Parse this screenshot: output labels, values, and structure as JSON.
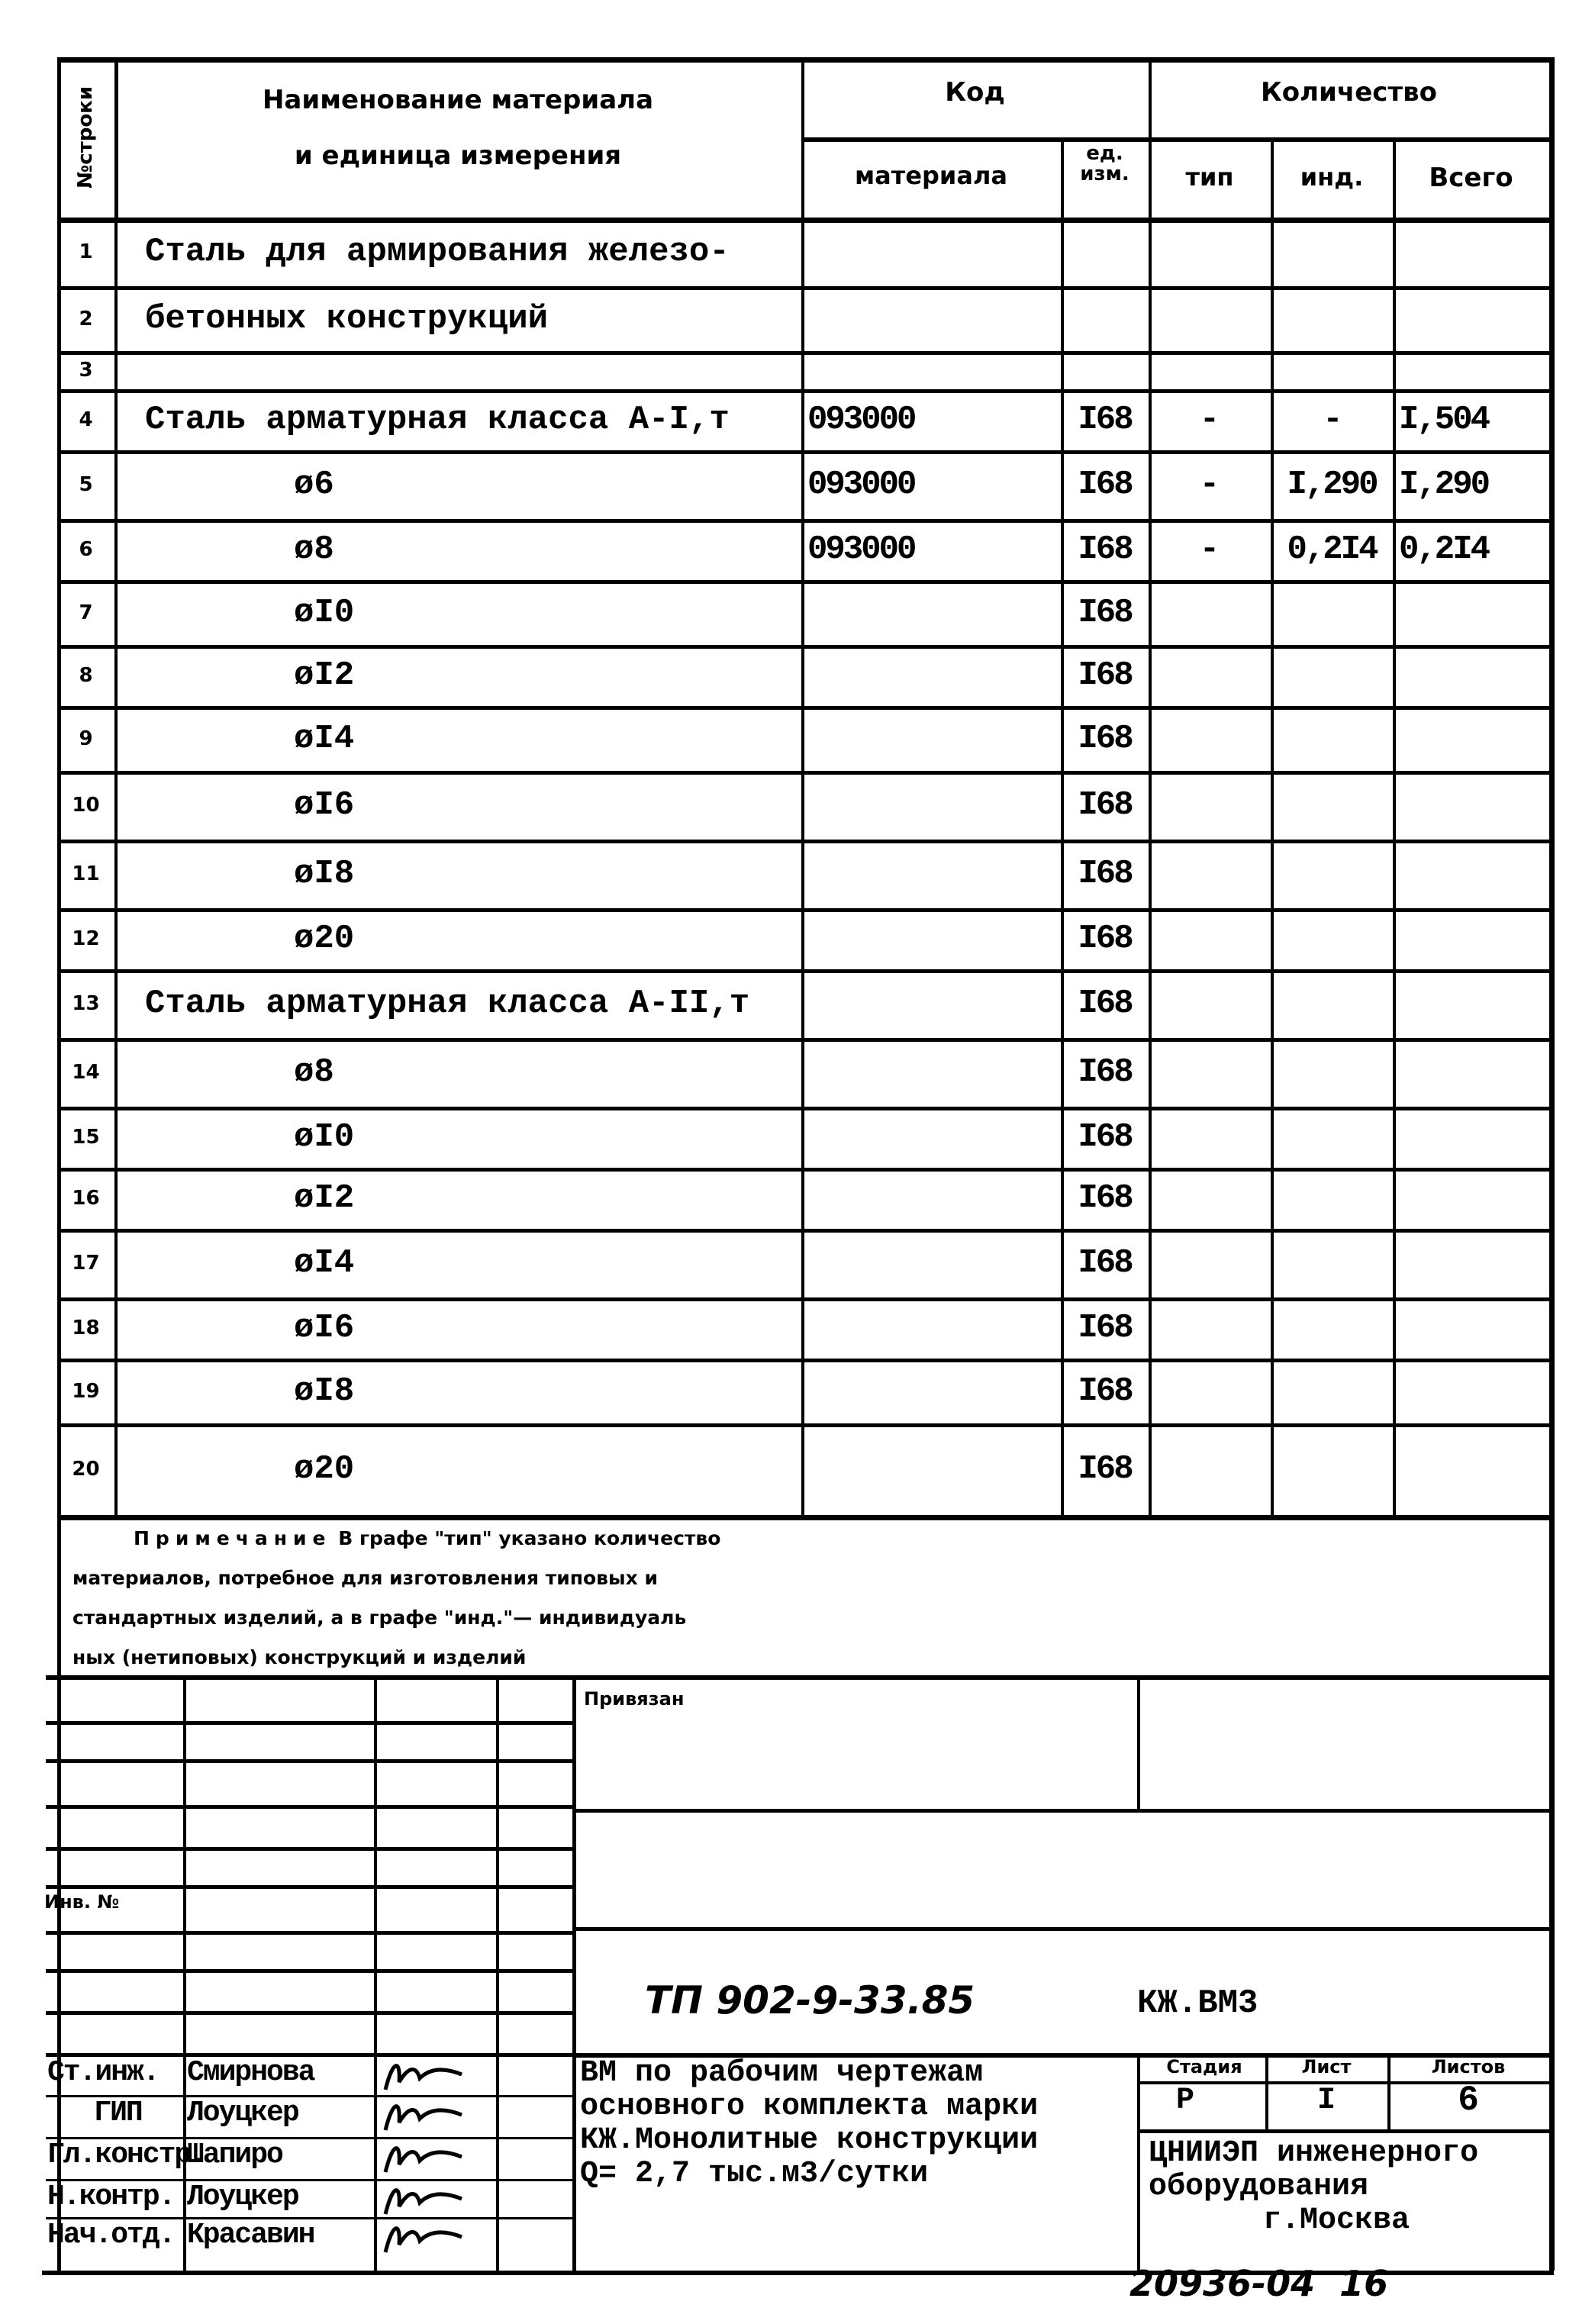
{
  "header": {
    "row_no_label": "№строки",
    "name_label_line1": "Наименование материала",
    "name_label_line2": "и единица измерения",
    "code_group": "Код",
    "code_material": "материала",
    "code_unit_line1": "ед.",
    "code_unit_line2": "изм.",
    "quantity_group": "Количество",
    "qty_type": "тип",
    "qty_ind": "инд.",
    "qty_total": "Всего"
  },
  "rows": [
    {
      "no": "1",
      "name": "Сталь для армирования железо-",
      "indent": false,
      "code": "",
      "unit": "",
      "type": "",
      "ind": "",
      "total": ""
    },
    {
      "no": "2",
      "name": "бетонных конструкций",
      "indent": false,
      "code": "",
      "unit": "",
      "type": "",
      "ind": "",
      "total": ""
    },
    {
      "no": "3",
      "name": "",
      "indent": false,
      "code": "",
      "unit": "",
      "type": "",
      "ind": "",
      "total": ""
    },
    {
      "no": "4",
      "name": "Сталь арматурная класса А-I,т",
      "indent": false,
      "code": "093000",
      "unit": "I68",
      "type": "-",
      "ind": "-",
      "total": "I,504"
    },
    {
      "no": "5",
      "name": "ø6",
      "indent": true,
      "code": "093000",
      "unit": "I68",
      "type": "-",
      "ind": "I,290",
      "total": "I,290"
    },
    {
      "no": "6",
      "name": "ø8",
      "indent": true,
      "code": "093000",
      "unit": "I68",
      "type": "-",
      "ind": "0,2I4",
      "total": "0,2I4"
    },
    {
      "no": "7",
      "name": "øI0",
      "indent": true,
      "code": "",
      "unit": "I68",
      "type": "",
      "ind": "",
      "total": ""
    },
    {
      "no": "8",
      "name": "øI2",
      "indent": true,
      "code": "",
      "unit": "I68",
      "type": "",
      "ind": "",
      "total": ""
    },
    {
      "no": "9",
      "name": "øI4",
      "indent": true,
      "code": "",
      "unit": "I68",
      "type": "",
      "ind": "",
      "total": ""
    },
    {
      "no": "10",
      "name": "øI6",
      "indent": true,
      "code": "",
      "unit": "I68",
      "type": "",
      "ind": "",
      "total": ""
    },
    {
      "no": "11",
      "name": "øI8",
      "indent": true,
      "code": "",
      "unit": "I68",
      "type": "",
      "ind": "",
      "total": ""
    },
    {
      "no": "12",
      "name": "ø20",
      "indent": true,
      "code": "",
      "unit": "I68",
      "type": "",
      "ind": "",
      "total": ""
    },
    {
      "no": "13",
      "name": "Сталь арматурная класса А-II,т",
      "indent": false,
      "code": "",
      "unit": "I68",
      "type": "",
      "ind": "",
      "total": ""
    },
    {
      "no": "14",
      "name": "ø8",
      "indent": true,
      "code": "",
      "unit": "I68",
      "type": "",
      "ind": "",
      "total": ""
    },
    {
      "no": "15",
      "name": "øI0",
      "indent": true,
      "code": "",
      "unit": "I68",
      "type": "",
      "ind": "",
      "total": ""
    },
    {
      "no": "16",
      "name": "øI2",
      "indent": true,
      "code": "",
      "unit": "I68",
      "type": "",
      "ind": "",
      "total": ""
    },
    {
      "no": "17",
      "name": "øI4",
      "indent": true,
      "code": "",
      "unit": "I68",
      "type": "",
      "ind": "",
      "total": ""
    },
    {
      "no": "18",
      "name": "øI6",
      "indent": true,
      "code": "",
      "unit": "I68",
      "type": "",
      "ind": "",
      "total": ""
    },
    {
      "no": "19",
      "name": "øI8",
      "indent": true,
      "code": "",
      "unit": "I68",
      "type": "",
      "ind": "",
      "total": ""
    },
    {
      "no": "20",
      "name": "ø20",
      "indent": true,
      "code": "",
      "unit": "I68",
      "type": "",
      "ind": "",
      "total": ""
    }
  ],
  "note": {
    "lead": "Примечание",
    "line1_rest": "В графе \"тип\" указано количество",
    "line2": "материалов, потребное для изготовления типовых и",
    "line3": "стандартных изделий, а в графе \"инд.\"— индивидуаль",
    "line4": "ных (нетиповых) конструкций и изделий"
  },
  "title_block": {
    "bound_label": "Привязан",
    "inv_no_label": "Инв. №",
    "doc_code": "ТП 902-9-33.85",
    "doc_mark": "КЖ.ВМ3",
    "signatures": [
      {
        "role": "Ст.инж.",
        "name": "Смирнова"
      },
      {
        "role": "ГИП",
        "name": "Лоуцкер"
      },
      {
        "role": "Гл.констр.",
        "name": "Шапиро"
      },
      {
        "role": "Н.контр.",
        "name": "Лоуцкер"
      },
      {
        "role": "Нач.отд.",
        "name": "Красавин"
      }
    ],
    "description_lines": [
      "ВМ по рабочим чертежам",
      "основного комплекта марки",
      "КЖ.Монолитные конструкции",
      "Q= 2,7 тыс.м3/сутки"
    ],
    "stage_label": "Стадия",
    "sheet_label": "Лист",
    "sheets_label": "Листов",
    "stage_value": "Р",
    "sheet_value": "I",
    "sheets_value": "6",
    "org_lines": [
      "ЦНИИЭП инженерного",
      "оборудования",
      "г.Москва"
    ]
  },
  "footer_stamp": "20936-04  16"
}
